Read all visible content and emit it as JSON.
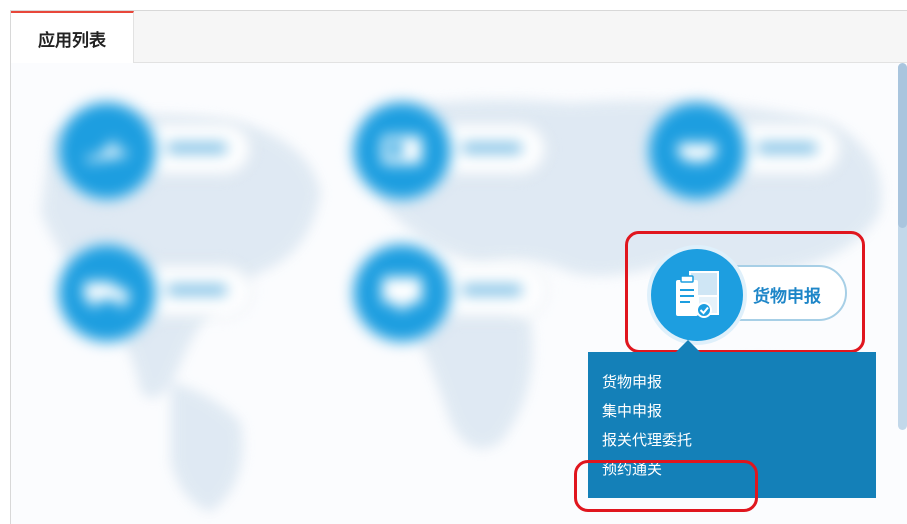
{
  "tabs": {
    "active_label": "应用列表"
  },
  "featured_app": {
    "label": "货物申报",
    "icon": "cargo-boxes-icon"
  },
  "blurred_apps": [
    {
      "icon": "plane-icon"
    },
    {
      "icon": "screen-form-icon"
    },
    {
      "icon": "handshake-icon"
    },
    {
      "icon": "truck-icon"
    },
    {
      "icon": "monitor-icon"
    }
  ],
  "dropdown": {
    "items": [
      "货物申报",
      "集中申报",
      "报关代理委托",
      "预约通关"
    ]
  },
  "colors": {
    "accent": "#1d9ee0",
    "menu_bg": "#1480b8",
    "highlight": "#e0161e",
    "tab_border": "#e8473a"
  }
}
